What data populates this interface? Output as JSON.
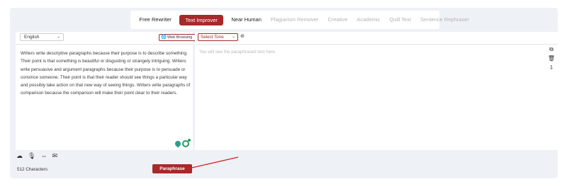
{
  "tabs": [
    {
      "label": "Free Rewriter"
    },
    {
      "label": "Text Improver"
    },
    {
      "label": "Near Human"
    },
    {
      "label": "Plagiarism Remover"
    },
    {
      "label": "Creative"
    },
    {
      "label": "Academic"
    },
    {
      "label": "Quill Text"
    },
    {
      "label": "Sentence Rephraser"
    }
  ],
  "input": {
    "language": "English",
    "web_browsing": "Web Browsing",
    "text": "Writers write descriptive paragraphs because their purpose is to describe something. Their point is that something is beautiful or disgusting or strangely intriguing. Writers write persuasive and argument paragraphs because their purpose is to persuade or convince someone. Their point is that their reader should see things a particular way and possibly take action on that new way of seeing things. Writers write paragraphs of comparison because the comparison will make their point clear to their readers.",
    "char_count": "512 Characters",
    "paraphrase_label": "Paraphrase"
  },
  "output": {
    "tone_select": "Select Tone",
    "placeholder": "You will see the paraphrased text here."
  },
  "icons": {
    "help": "help-icon",
    "right_toolbar": [
      "copy-icon",
      "trash-icon",
      "download-icon"
    ],
    "bottom_toolbar": [
      "upload-cloud-icon",
      "microphone-icon",
      "link-icon",
      "image-icon"
    ]
  },
  "colors": {
    "accent": "#a52a2a",
    "annotation_arrow": "#d42020"
  }
}
